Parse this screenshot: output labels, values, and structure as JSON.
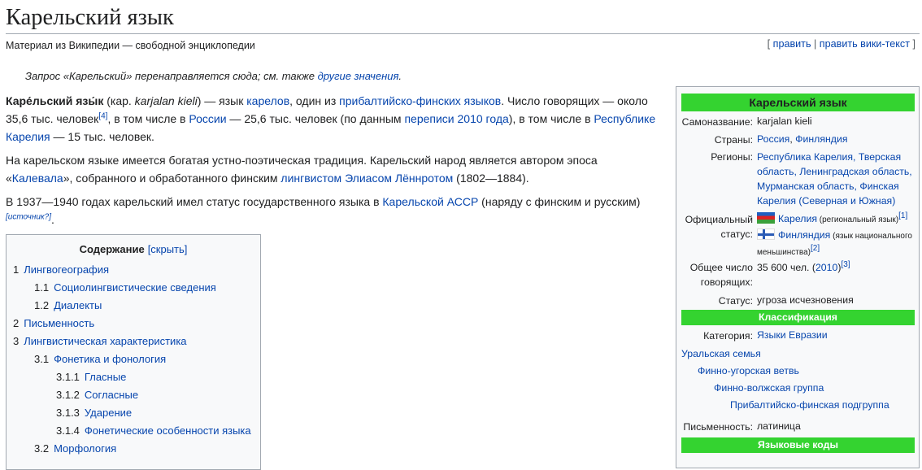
{
  "page": {
    "title": "Карельский язык",
    "subtitle": "Материал из Википедии — свободной энциклопедии",
    "edit_open": "[ ",
    "edit": "править",
    "edit_sep": " | ",
    "edit_wiki": "править вики-текст",
    "edit_close": " ]"
  },
  "hatnote": {
    "text": "Запрос «Карельский» перенаправляется сюда; см. также ",
    "link": "другие значения",
    "end": "."
  },
  "para1": {
    "b1": "Каре́льский язы́к",
    "t1": " (кар. ",
    "i1": "karjalan kieli",
    "t2": ") — язык ",
    "l1": "карелов",
    "t3": ", один из ",
    "l2": "прибалтийско-финских языков",
    "t4": ". Число говорящих — около 35,6 тыс. человек",
    "s1": "[4]",
    "t5": ", в том числе в ",
    "l3": "России",
    "t6": " — 25,6 тыс. человек (по данным ",
    "l4": "переписи 2010 года",
    "t7": "), в том числе в ",
    "l5": "Республике Карелия",
    "t8": " — 15 тыс. человек."
  },
  "para2": {
    "t1": "На карельском языке имеется богатая устно-поэтическая традиция. Карельский народ является автором эпоса «",
    "l1": "Калевала",
    "t2": "», собранного и обработанного финским ",
    "l2": "лингвистом",
    "t3": " ",
    "l3": "Элиасом Лённротом",
    "t4": " (1802—1884)."
  },
  "para3": {
    "t1": "В 1937—1940 годах карельский имел статус государственного языка в ",
    "l1": "Карельской АССР",
    "t2": " (наряду с финским и русским)",
    "s1": "[источник?]",
    "t3": "."
  },
  "toc": {
    "title": "Содержание",
    "toggle": "[скрыть]",
    "items": [
      {
        "num": "1",
        "label": "Лингвогеография",
        "level": 1
      },
      {
        "num": "1.1",
        "label": "Социолингвистические сведения",
        "level": 2
      },
      {
        "num": "1.2",
        "label": "Диалекты",
        "level": 2
      },
      {
        "num": "2",
        "label": "Письменность",
        "level": 1
      },
      {
        "num": "3",
        "label": "Лингвистическая характеристика",
        "level": 1
      },
      {
        "num": "3.1",
        "label": "Фонетика и фонология",
        "level": 2
      },
      {
        "num": "3.1.1",
        "label": "Гласные",
        "level": 3
      },
      {
        "num": "3.1.2",
        "label": "Согласные",
        "level": 3
      },
      {
        "num": "3.1.3",
        "label": "Ударение",
        "level": 3
      },
      {
        "num": "3.1.4",
        "label": "Фонетические особенности языка",
        "level": 3
      },
      {
        "num": "3.2",
        "label": "Морфология",
        "level": 2
      }
    ]
  },
  "infobox": {
    "title": "Карельский язык",
    "selfname_label": "Самоназвание:",
    "selfname": "karjalan kieli",
    "countries_label": "Страны:",
    "country1": "Россия",
    "country_sep": ", ",
    "country2": "Финляндия",
    "regions_label": "Регионы:",
    "regions": "Республика Карелия, Тверская область, Ленинградская область, Мурманская область, Финская Карелия (Северная и Южная)",
    "official_label": "Официальный статус:",
    "official1_link": "Карелия",
    "official1_note": " (региональный язык)",
    "official1_ref": "[1]",
    "official2_link": "Финляндия",
    "official2_note": " (язык национального меньшинства)",
    "official2_ref": "[2]",
    "speakers_label": "Общее число говорящих:",
    "speakers": "35 600 чел. (",
    "speakers_year": "2010",
    "speakers_end": ")",
    "speakers_ref": "[3]",
    "status_label": "Статус:",
    "status": "угроза исчезновения",
    "classification": "Классификация",
    "category_label": "Категория:",
    "category": "Языки Евразии",
    "family": "Уральская семья",
    "branch": "Финно-угорская ветвь",
    "group": "Финно-волжская группа",
    "subgroup": "Прибалтийско-финская подгруппа",
    "script_label": "Письменность:",
    "script": "латиница",
    "codes": "Языковые коды"
  }
}
